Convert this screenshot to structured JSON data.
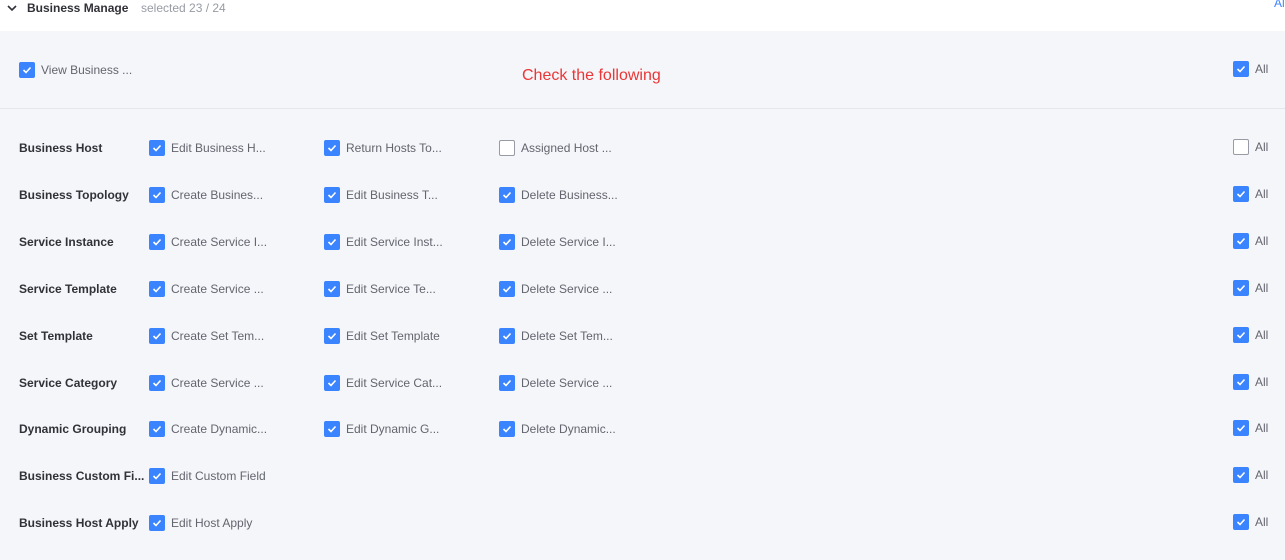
{
  "header": {
    "title": "Business Manage",
    "selected": "selected 23 / 24",
    "corner_link": "All"
  },
  "top": {
    "view_label": "View Business ...",
    "view_checked": true,
    "hint": "Check the following",
    "all_label": "All",
    "all_checked": true
  },
  "rows": [
    {
      "label": "Business Host",
      "items": [
        {
          "label": "Edit Business H...",
          "checked": true
        },
        {
          "label": "Return Hosts To...",
          "checked": true
        },
        {
          "label": "Assigned Host ...",
          "checked": false
        }
      ],
      "all_label": "All",
      "all_checked": false
    },
    {
      "label": "Business Topology",
      "items": [
        {
          "label": "Create Busines...",
          "checked": true
        },
        {
          "label": "Edit Business T...",
          "checked": true
        },
        {
          "label": "Delete Business...",
          "checked": true
        }
      ],
      "all_label": "All",
      "all_checked": true
    },
    {
      "label": "Service Instance",
      "items": [
        {
          "label": "Create Service I...",
          "checked": true
        },
        {
          "label": "Edit Service Inst...",
          "checked": true
        },
        {
          "label": "Delete Service I...",
          "checked": true
        }
      ],
      "all_label": "All",
      "all_checked": true
    },
    {
      "label": "Service Template",
      "items": [
        {
          "label": "Create Service ...",
          "checked": true
        },
        {
          "label": "Edit Service Te...",
          "checked": true
        },
        {
          "label": "Delete Service ...",
          "checked": true
        }
      ],
      "all_label": "All",
      "all_checked": true
    },
    {
      "label": "Set Template",
      "items": [
        {
          "label": "Create Set Tem...",
          "checked": true
        },
        {
          "label": "Edit Set Template",
          "checked": true
        },
        {
          "label": "Delete Set Tem...",
          "checked": true
        }
      ],
      "all_label": "All",
      "all_checked": true
    },
    {
      "label": "Service Category",
      "items": [
        {
          "label": "Create Service ...",
          "checked": true
        },
        {
          "label": "Edit Service Cat...",
          "checked": true
        },
        {
          "label": "Delete Service ...",
          "checked": true
        }
      ],
      "all_label": "All",
      "all_checked": true
    },
    {
      "label": "Dynamic Grouping",
      "items": [
        {
          "label": "Create Dynamic...",
          "checked": true
        },
        {
          "label": "Edit Dynamic G...",
          "checked": true
        },
        {
          "label": "Delete Dynamic...",
          "checked": true
        }
      ],
      "all_label": "All",
      "all_checked": true
    },
    {
      "label": "Business Custom Fi...",
      "items": [
        {
          "label": "Edit Custom Field",
          "checked": true
        }
      ],
      "all_label": "All",
      "all_checked": true
    },
    {
      "label": "Business Host Apply",
      "items": [
        {
          "label": "Edit Host Apply",
          "checked": true
        }
      ],
      "all_label": "All",
      "all_checked": true
    }
  ],
  "colors": {
    "accent": "#3a84ff",
    "hint": "#ea3636",
    "panel_bg": "#f5f6fa"
  }
}
